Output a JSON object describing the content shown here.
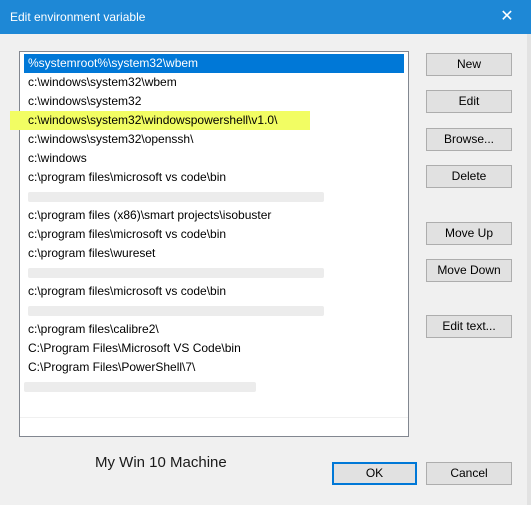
{
  "window": {
    "title": "Edit environment variable",
    "close_glyph": "✕"
  },
  "list": {
    "items": [
      "%systemroot%\\system32\\wbem",
      "c:\\windows\\system32\\wbem",
      "c:\\windows\\system32",
      "c:\\windows\\system32\\windowspowershell\\v1.0\\",
      "c:\\windows\\system32\\openssh\\",
      "c:\\windows",
      "c:\\program files\\microsoft vs code\\bin",
      "",
      "c:\\program files (x86)\\smart projects\\isobuster",
      "c:\\program files\\microsoft vs code\\bin",
      "c:\\program files\\wureset",
      "",
      "c:\\program files\\microsoft vs code\\bin",
      "",
      "c:\\program files\\calibre2\\",
      "C:\\Program Files\\Microsoft VS Code\\bin",
      "C:\\Program Files\\PowerShell\\7\\",
      ""
    ],
    "selected_index": 0,
    "highlight_index": 3,
    "colors": {
      "selection": "#0078d7",
      "highlight": "#f2fd63"
    }
  },
  "buttons": {
    "new": "New",
    "edit": "Edit",
    "browse": "Browse...",
    "delete": "Delete",
    "move_up": "Move Up",
    "move_down": "Move Down",
    "edit_text": "Edit text...",
    "ok": "OK",
    "cancel": "Cancel"
  },
  "caption": "My Win 10 Machine",
  "colors": {
    "titlebar": "#1e88d6",
    "accent": "#0078d7"
  }
}
